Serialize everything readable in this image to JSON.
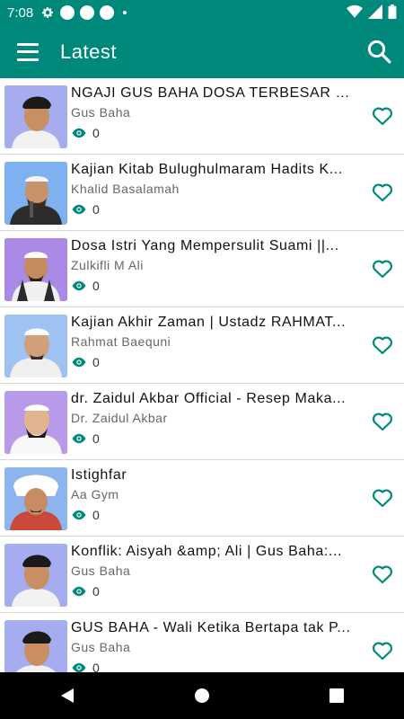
{
  "status_bar": {
    "time": "7:08"
  },
  "app_bar": {
    "title": "Latest"
  },
  "colors": {
    "primary": "#00897b",
    "icon_teal": "#00897b"
  },
  "items": [
    {
      "title": "NGAJI GUS BAHA DOSA TERBESAR SEO...",
      "author": "Gus Baha",
      "views": "0"
    },
    {
      "title": "Kajian Kitab Bulughulmaram Hadits K...",
      "author": "Khalid Basalamah",
      "views": "0"
    },
    {
      "title": "Dosa Istri Yang Mempersulit Suami ||...",
      "author": "Zulkifli M Ali",
      "views": "0"
    },
    {
      "title": "Kajian Akhir Zaman | Ustadz RAHMAT...",
      "author": "Rahmat Baequni",
      "views": "0"
    },
    {
      "title": "dr. Zaidul Akbar Official - Resep Maka...",
      "author": "Dr. Zaidul Akbar",
      "views": "0"
    },
    {
      "title": "Istighfar",
      "author": "Aa Gym",
      "views": "0"
    },
    {
      "title": "Konflik: Aisyah &amp; Ali | Gus Baha:...",
      "author": "Gus Baha",
      "views": "0"
    },
    {
      "title": "GUS BAHA - Wali Ketika Bertapa tak P...",
      "author": "Gus Baha",
      "views": "0"
    }
  ]
}
